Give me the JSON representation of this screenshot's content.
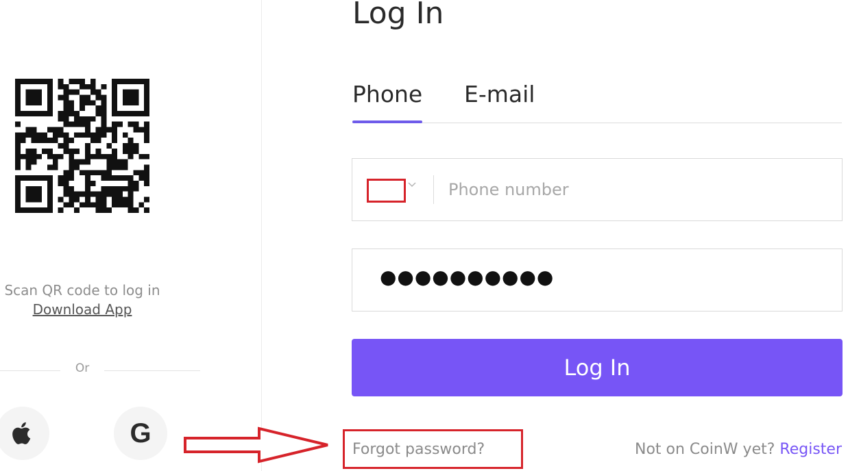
{
  "page": {
    "title": "Log In"
  },
  "left": {
    "scan_text": "Scan QR code to log in",
    "download_label": "Download App",
    "or_label": "Or",
    "social": [
      {
        "name": "apple-icon"
      },
      {
        "name": "google-icon",
        "glyph": "G"
      }
    ]
  },
  "tabs": {
    "phone_label": "Phone",
    "email_label": "E-mail",
    "active": "Phone"
  },
  "form": {
    "phone_placeholder": "Phone number",
    "phone_value": "",
    "password_masked": "●●●●●●●●●●",
    "login_label": "Log In"
  },
  "footer": {
    "forgot_label": "Forgot password?",
    "not_on_label": "Not on CoinW yet?",
    "register_label": "Register"
  },
  "colors": {
    "accent": "#7755f6",
    "highlight": "#d6232a"
  }
}
